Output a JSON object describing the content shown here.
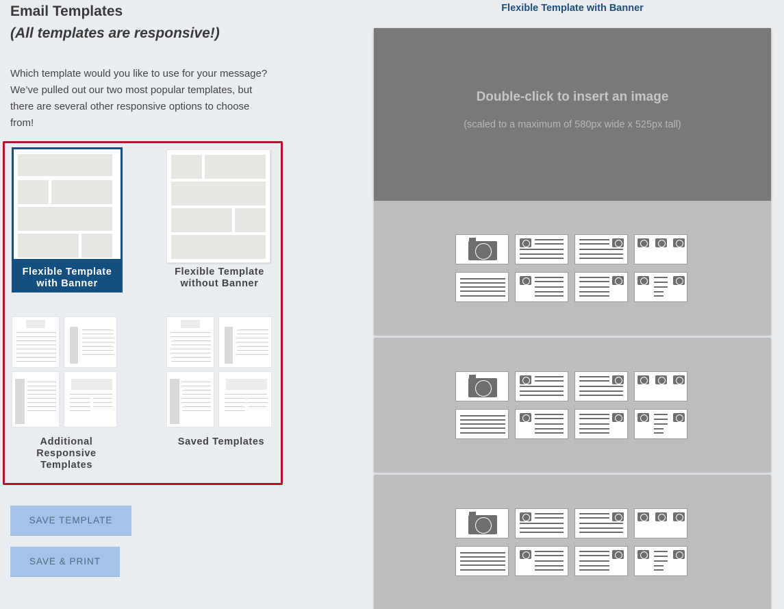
{
  "left": {
    "title": "Email Templates",
    "subtitle": "(All templates are responsive!)",
    "intro": "Which template would you like to use for your message? We’ve pulled out our two most popular templates, but there are several other responsive options to choose from!",
    "templates": [
      {
        "label": "Flexible Template with Banner",
        "selected": true
      },
      {
        "label": "Flexible Template without Banner",
        "selected": false
      },
      {
        "label": "Additional Responsive Templates",
        "selected": false
      },
      {
        "label": "Saved Templates",
        "selected": false
      }
    ],
    "buttons": {
      "save_template": "SAVE TEMPLATE",
      "save_print": "SAVE & PRINT"
    }
  },
  "preview": {
    "title": "Flexible Template with Banner",
    "banner_main": "Double-click to insert an image",
    "banner_sub": "(scaled to a maximum of 580px wide x 525px tall)"
  },
  "colors": {
    "selected": "#154f80",
    "highlight_border": "#b5122b",
    "button": "#a3c4e6",
    "background": "#e9edf2"
  }
}
